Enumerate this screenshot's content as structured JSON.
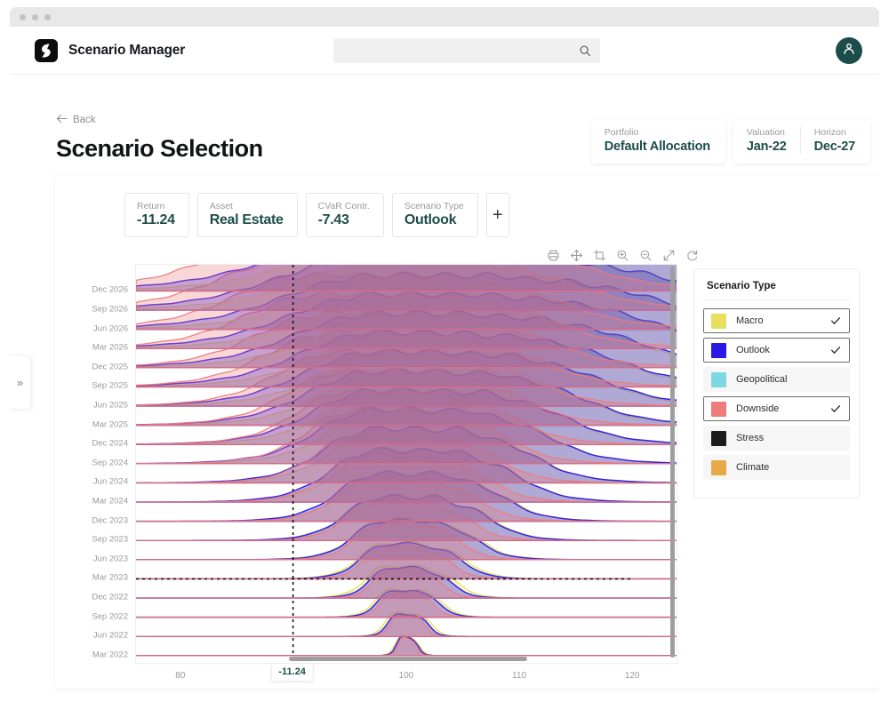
{
  "window": {
    "dots": 3
  },
  "topnav": {
    "brand_title": "Scenario Manager",
    "logo_icon": "logo-mark-icon",
    "search_placeholder": "",
    "search_value": "",
    "search_icon": "search-icon",
    "avatar_icon": "user-avatar-icon"
  },
  "sidebar": {
    "expand_label": "»",
    "expand_icon": "chevron-double-right-icon"
  },
  "page": {
    "back_label": "Back",
    "back_icon": "arrow-left-icon",
    "title": "Scenario Selection"
  },
  "meta": [
    {
      "label": "Portfolio",
      "value": "Default Allocation"
    },
    {
      "label": "Valuation",
      "value": "Jan-22"
    },
    {
      "label": "Horizon",
      "value": "Dec-27"
    }
  ],
  "filters": {
    "chips": [
      {
        "label": "Return",
        "value": "-11.24"
      },
      {
        "label": "Asset",
        "value": "Real Estate"
      },
      {
        "label": "CVaR Contr.",
        "value": "-7.43"
      },
      {
        "label": "Scenario Type",
        "value": "Outlook"
      }
    ],
    "add_label": "+"
  },
  "plot_toolbar": [
    {
      "name": "download-plot-icon",
      "title": "Download plot"
    },
    {
      "name": "pan-icon",
      "title": "Pan"
    },
    {
      "name": "box-select-icon",
      "title": "Box select"
    },
    {
      "name": "zoom-in-icon",
      "title": "Zoom in"
    },
    {
      "name": "zoom-out-icon",
      "title": "Zoom out"
    },
    {
      "name": "autoscale-icon",
      "title": "Autoscale"
    },
    {
      "name": "reset-axes-icon",
      "title": "Reset axes"
    }
  ],
  "legend": {
    "title": "Scenario Type",
    "check_icon": "check-icon",
    "items": [
      {
        "label": "Macro",
        "color": "#e7df5e",
        "selected": true
      },
      {
        "label": "Outlook",
        "color": "#2a18e6",
        "selected": true
      },
      {
        "label": "Geopolitical",
        "color": "#7ed8e2",
        "selected": false
      },
      {
        "label": "Downside",
        "color": "#ef7b7b",
        "selected": true
      },
      {
        "label": "Stress",
        "color": "#1d1d1d",
        "selected": false
      },
      {
        "label": "Climate",
        "color": "#e8a949",
        "selected": false
      }
    ]
  },
  "chart_data": {
    "type": "area",
    "title": "",
    "subtitle": "",
    "xlabel": "",
    "ylabel": "",
    "xlim": [
      76,
      124
    ],
    "x_ticks": [
      80,
      100,
      110,
      120
    ],
    "grid": false,
    "legend_position": "right",
    "crosshair": {
      "x_value": -11.24,
      "x_label": "-11.24",
      "y_category": "Mar 2023"
    },
    "categories": [
      "Dec 2026",
      "Sep 2026",
      "Jun 2026",
      "Mar 2026",
      "Dec 2025",
      "Sep 2025",
      "Jun 2025",
      "Mar 2025",
      "Dec 2024",
      "Sep 2024",
      "Jun 2024",
      "Mar 2024",
      "Dec 2023",
      "Sep 2023",
      "Jun 2023",
      "Mar 2023",
      "Dec 2022",
      "Sep 2022",
      "Jun 2022",
      "Mar 2022"
    ],
    "series": [
      {
        "name": "Macro",
        "color": "#e7df5e",
        "means": [
          107.8,
          107.2,
          106.6,
          106.0,
          105.4,
          104.8,
          104.2,
          103.6,
          103.1,
          102.6,
          102.1,
          101.7,
          101.3,
          100.9,
          100.6,
          100.35,
          100.2,
          100.1,
          100.05,
          100.0
        ],
        "widths": [
          12.5,
          11.9,
          11.3,
          10.7,
          10.1,
          9.5,
          8.9,
          8.3,
          7.7,
          7.1,
          6.5,
          5.9,
          5.3,
          4.7,
          4.1,
          3.5,
          2.9,
          2.2,
          1.5,
          0.8
        ]
      },
      {
        "name": "Outlook",
        "color": "#2a18e6",
        "means": [
          106.4,
          105.9,
          105.4,
          104.9,
          104.4,
          103.9,
          103.4,
          102.9,
          102.4,
          101.9,
          101.5,
          101.2,
          100.9,
          100.7,
          100.5,
          100.3,
          100.2,
          100.1,
          100.05,
          100.0
        ],
        "widths": [
          13.8,
          13.1,
          12.4,
          11.7,
          11.0,
          10.3,
          9.6,
          8.9,
          8.2,
          7.5,
          6.8,
          6.1,
          5.4,
          4.7,
          4.0,
          3.3,
          2.6,
          2.0,
          1.3,
          0.7
        ]
      },
      {
        "name": "Downside",
        "color": "#ef7b7b",
        "means": [
          98.2,
          98.4,
          98.6,
          98.8,
          99.0,
          99.1,
          99.3,
          99.4,
          99.5,
          99.6,
          99.7,
          99.8,
          99.85,
          99.9,
          99.92,
          99.95,
          99.97,
          99.98,
          99.99,
          100.0
        ],
        "widths": [
          11.8,
          11.2,
          10.6,
          10.0,
          9.4,
          8.8,
          8.2,
          7.6,
          7.0,
          6.4,
          5.8,
          5.2,
          4.6,
          4.0,
          3.4,
          2.8,
          2.2,
          1.7,
          1.1,
          0.6
        ]
      }
    ]
  }
}
